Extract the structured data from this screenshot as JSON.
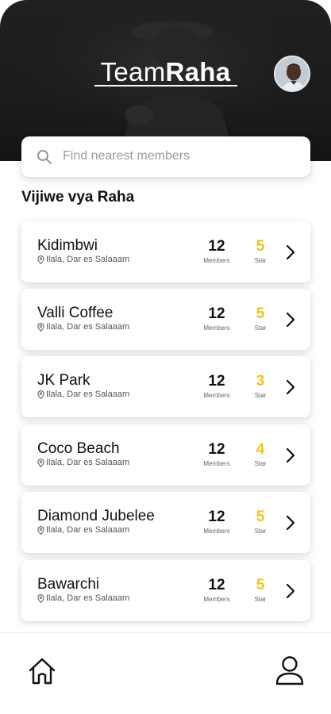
{
  "header": {
    "brand_part1": "Team",
    "brand_part2": "Raha"
  },
  "search": {
    "placeholder": "Find nearest members",
    "value": ""
  },
  "section": {
    "title": "Vijiwe vya Raha"
  },
  "colors": {
    "accent_star": "#f2c31b",
    "hero_bg": "#1c1c1c"
  },
  "labels": {
    "members": "Members",
    "star": "Star"
  },
  "vijiwe": [
    {
      "name": "Kidimbwi",
      "location": "Ilala, Dar es Salaaam",
      "members": "12",
      "stars": "5"
    },
    {
      "name": "Valli Coffee",
      "location": "Ilala, Dar es Salaaam",
      "members": "12",
      "stars": "5"
    },
    {
      "name": "JK Park",
      "location": "Ilala, Dar es Salaaam",
      "members": "12",
      "stars": "3"
    },
    {
      "name": "Coco Beach",
      "location": "Ilala, Dar es Salaaam",
      "members": "12",
      "stars": "4"
    },
    {
      "name": "Diamond Jubelee",
      "location": "Ilala, Dar es Salaaam",
      "members": "12",
      "stars": "5"
    },
    {
      "name": "Bawarchi",
      "location": "Ilala, Dar es Salaaam",
      "members": "12",
      "stars": "5"
    }
  ],
  "icons": {
    "search": "search-icon",
    "pin": "location-pin-icon",
    "chevron": "chevron-right-icon",
    "home": "home-icon",
    "profile": "user-icon"
  }
}
